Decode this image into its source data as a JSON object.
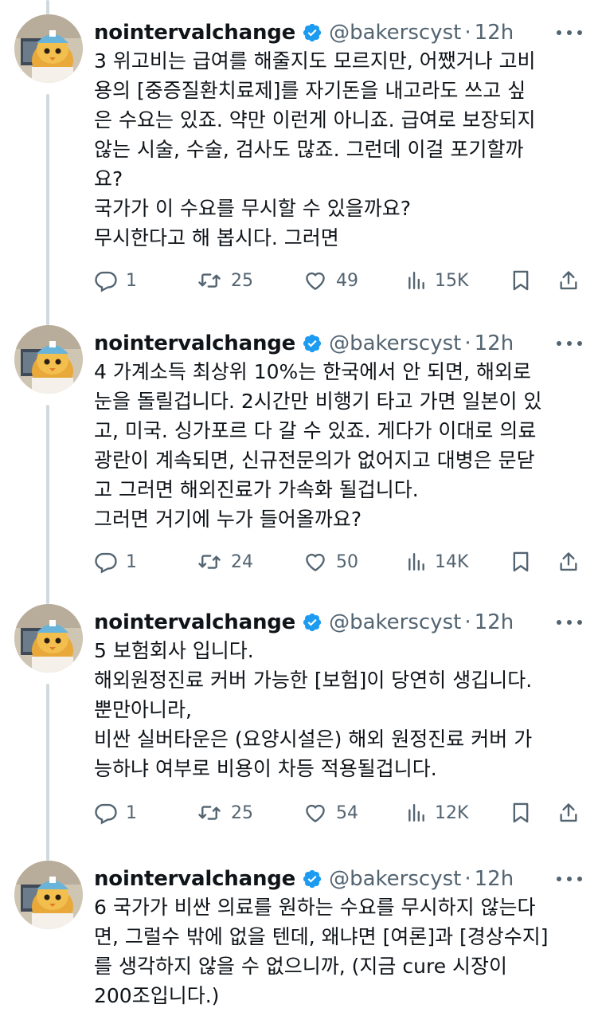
{
  "colors": {
    "text": "#0f1419",
    "secondary": "#536471",
    "verified": "#1d9bf0",
    "thread_line": "#cfd9de"
  },
  "tweets": [
    {
      "name": "nointervalchange",
      "handle": "@bakerscyst",
      "time": "12h",
      "lines": [
        "3 위고비는 급여를 해줄지도 모르지만, 어쨌거나 고비",
        "용의 [중증질환치료제]를 자기돈을 내고라도 쓰고 싶",
        "은 수요는 있죠. 약만 이런게 아니죠. 급여로 보장되지",
        "않는 시술, 수술, 검사도 많죠. 그런데 이걸 포기할까",
        "요?",
        "국가가 이 수요를 무시할 수 있을까요?",
        "무시한다고 해 봅시다. 그러면"
      ],
      "replies": "1",
      "retweets": "25",
      "likes": "49",
      "views": "15K"
    },
    {
      "name": "nointervalchange",
      "handle": "@bakerscyst",
      "time": "12h",
      "lines": [
        "4 가계소득 최상위 10%는 한국에서 안 되면, 해외로",
        "눈을 돌릴겁니다. 2시간만 비행기 타고 가면 일본이 있",
        "고, 미국. 싱가포르 다 갈 수 있죠. 게다가 이대로 의료",
        "광란이 계속되면, 신규전문의가 없어지고 대병은 문닫",
        "고 그러면 해외진료가 가속화 될겁니다.",
        "그러면 거기에 누가 들어올까요?"
      ],
      "replies": "1",
      "retweets": "24",
      "likes": "50",
      "views": "14K"
    },
    {
      "name": "nointervalchange",
      "handle": "@bakerscyst",
      "time": "12h",
      "lines": [
        "5 보험회사 입니다.",
        "해외원정진료 커버 가능한 [보험]이 당연히 생깁니다.",
        "뿐만아니라,",
        "비싼 실버타운은 (요양시설은) 해외 원정진료 커버 가",
        "능하냐 여부로 비용이 차등 적용될겁니다."
      ],
      "replies": "1",
      "retweets": "25",
      "likes": "54",
      "views": "12K"
    },
    {
      "name": "nointervalchange",
      "handle": "@bakerscyst",
      "time": "12h",
      "lines": [
        "6 국가가 비싼 의료를 원하는 수요를 무시하지 않는다",
        "면, 그럴수 밖에 없을 텐데, 왜냐면 [여론]과 [경상수지]",
        "를 생각하지 않을 수 없으니까, (지금 cure 시장이",
        "200조입니다.)"
      ]
    }
  ]
}
